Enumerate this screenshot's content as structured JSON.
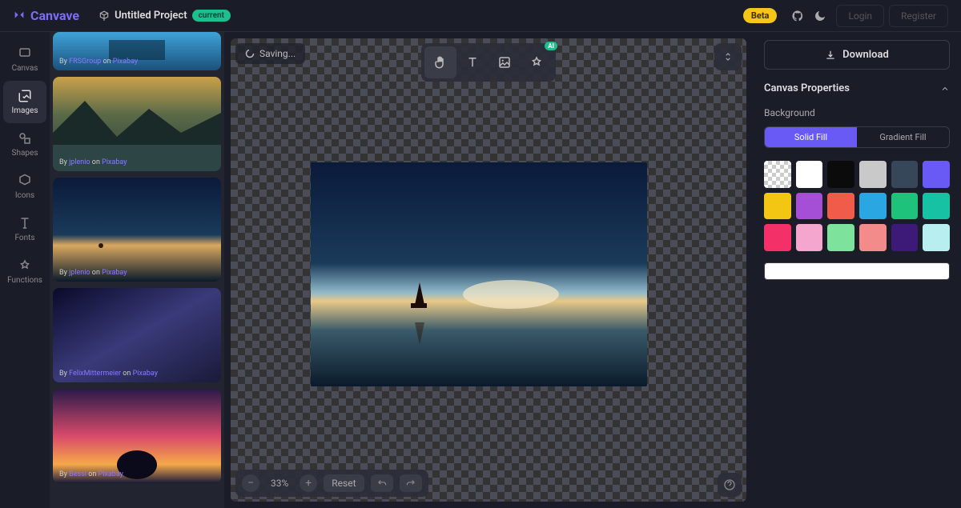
{
  "topbar": {
    "brand": "Canvave",
    "project_name": "Untitled Project",
    "current_badge": "current",
    "beta_badge": "Beta",
    "login_label": "Login",
    "register_label": "Register"
  },
  "sidebar": {
    "items": [
      {
        "label": "Canvas"
      },
      {
        "label": "Images"
      },
      {
        "label": "Shapes"
      },
      {
        "label": "Icons"
      },
      {
        "label": "Fonts"
      },
      {
        "label": "Functions"
      }
    ]
  },
  "image_panel": {
    "thumbs": [
      {
        "by": "By ",
        "author": "FRSGroup",
        "on": " on ",
        "src": "Pixabay"
      },
      {
        "by": "By ",
        "author": "jplenio",
        "on": " on ",
        "src": "Pixabay"
      },
      {
        "by": "By ",
        "author": "jplenio",
        "on": " on ",
        "src": "Pixabay"
      },
      {
        "by": "By ",
        "author": "FelixMittermeier",
        "on": " on ",
        "src": "Pixabay"
      },
      {
        "by": "By ",
        "author": "Bessi",
        "on": " on ",
        "src": "Pixabay"
      }
    ]
  },
  "canvas": {
    "saving_label": "Saving...",
    "ai_badge": "AI",
    "zoom": "33%",
    "reset_label": "Reset"
  },
  "props": {
    "download_label": "Download",
    "section_title": "Canvas Properties",
    "bg_label": "Background",
    "fill_tabs": [
      "Solid Fill",
      "Gradient Fill"
    ],
    "swatches": [
      "transparent",
      "#ffffff",
      "#0b0b0b",
      "#c9c9c9",
      "#37475a",
      "#6a5af5",
      "#f3c613",
      "#a54fd6",
      "#f15b4a",
      "#2aa7e2",
      "#1ec27a",
      "#17c1a3",
      "#f43068",
      "#f4a6cf",
      "#7de39c",
      "#f38b8b",
      "#3d1a78",
      "#b8eef0"
    ],
    "color_value": "#ffffff"
  }
}
